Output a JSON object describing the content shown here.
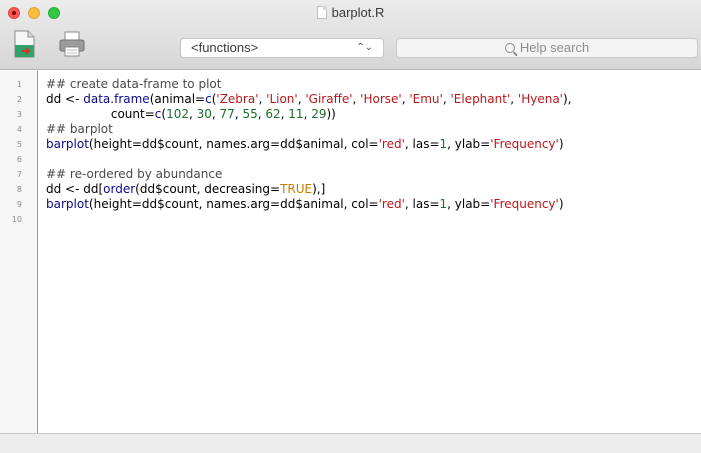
{
  "window": {
    "title": "barplot.R"
  },
  "toolbar": {
    "functions_label": "<functions>",
    "help_search_placeholder": "Help search"
  },
  "editor": {
    "lines": [
      {
        "num": "1",
        "tokens": [
          {
            "t": "comment",
            "v": "## create data-frame to plot"
          }
        ]
      },
      {
        "num": "2",
        "tokens": [
          {
            "t": "plain",
            "v": "dd <- "
          },
          {
            "t": "func",
            "v": "data.frame"
          },
          {
            "t": "plain",
            "v": "(animal="
          },
          {
            "t": "func",
            "v": "c"
          },
          {
            "t": "plain",
            "v": "("
          },
          {
            "t": "string",
            "v": "'Zebra'"
          },
          {
            "t": "plain",
            "v": ", "
          },
          {
            "t": "string",
            "v": "'Lion'"
          },
          {
            "t": "plain",
            "v": ", "
          },
          {
            "t": "string",
            "v": "'Giraffe'"
          },
          {
            "t": "plain",
            "v": ", "
          },
          {
            "t": "string",
            "v": "'Horse'"
          },
          {
            "t": "plain",
            "v": ", "
          },
          {
            "t": "string",
            "v": "'Emu'"
          },
          {
            "t": "plain",
            "v": ", "
          },
          {
            "t": "string",
            "v": "'Elephant'"
          },
          {
            "t": "plain",
            "v": ", "
          },
          {
            "t": "string",
            "v": "'Hyena'"
          },
          {
            "t": "plain",
            "v": "),"
          }
        ]
      },
      {
        "num": "3",
        "tokens": [
          {
            "t": "plain",
            "v": "                 count="
          },
          {
            "t": "func",
            "v": "c"
          },
          {
            "t": "plain",
            "v": "("
          },
          {
            "t": "number",
            "v": "102"
          },
          {
            "t": "plain",
            "v": ", "
          },
          {
            "t": "number",
            "v": "30"
          },
          {
            "t": "plain",
            "v": ", "
          },
          {
            "t": "number",
            "v": "77"
          },
          {
            "t": "plain",
            "v": ", "
          },
          {
            "t": "number",
            "v": "55"
          },
          {
            "t": "plain",
            "v": ", "
          },
          {
            "t": "number",
            "v": "62"
          },
          {
            "t": "plain",
            "v": ", "
          },
          {
            "t": "number",
            "v": "11"
          },
          {
            "t": "plain",
            "v": ", "
          },
          {
            "t": "number",
            "v": "29"
          },
          {
            "t": "plain",
            "v": "))"
          }
        ]
      },
      {
        "num": "4",
        "tokens": [
          {
            "t": "comment",
            "v": "## barplot"
          }
        ]
      },
      {
        "num": "5",
        "tokens": [
          {
            "t": "func",
            "v": "barplot"
          },
          {
            "t": "plain",
            "v": "(height=dd$count, names.arg=dd$animal, col="
          },
          {
            "t": "string",
            "v": "'red'"
          },
          {
            "t": "plain",
            "v": ", las="
          },
          {
            "t": "number",
            "v": "1"
          },
          {
            "t": "plain",
            "v": ", ylab="
          },
          {
            "t": "string",
            "v": "'Frequency'"
          },
          {
            "t": "plain",
            "v": ")"
          }
        ]
      },
      {
        "num": "6",
        "tokens": []
      },
      {
        "num": "7",
        "tokens": [
          {
            "t": "comment",
            "v": "## re-ordered by abundance"
          }
        ]
      },
      {
        "num": "8",
        "tokens": [
          {
            "t": "plain",
            "v": "dd <- dd["
          },
          {
            "t": "func",
            "v": "order"
          },
          {
            "t": "plain",
            "v": "(dd$count, decreasing="
          },
          {
            "t": "keyword",
            "v": "TRUE"
          },
          {
            "t": "plain",
            "v": "),]"
          }
        ]
      },
      {
        "num": "9",
        "tokens": [
          {
            "t": "func",
            "v": "barplot"
          },
          {
            "t": "plain",
            "v": "(height=dd$count, names.arg=dd$animal, col="
          },
          {
            "t": "string",
            "v": "'red'"
          },
          {
            "t": "plain",
            "v": ", las="
          },
          {
            "t": "number",
            "v": "1"
          },
          {
            "t": "plain",
            "v": ", ylab="
          },
          {
            "t": "string",
            "v": "'Frequency'"
          },
          {
            "t": "plain",
            "v": ")"
          }
        ]
      },
      {
        "num": "10",
        "tokens": []
      }
    ]
  },
  "colors": {
    "comment": "#4a4a4a",
    "func": "#0a0a8a",
    "string": "#b6171b",
    "number": "#1b6e2e",
    "keyword": "#c67c00"
  }
}
